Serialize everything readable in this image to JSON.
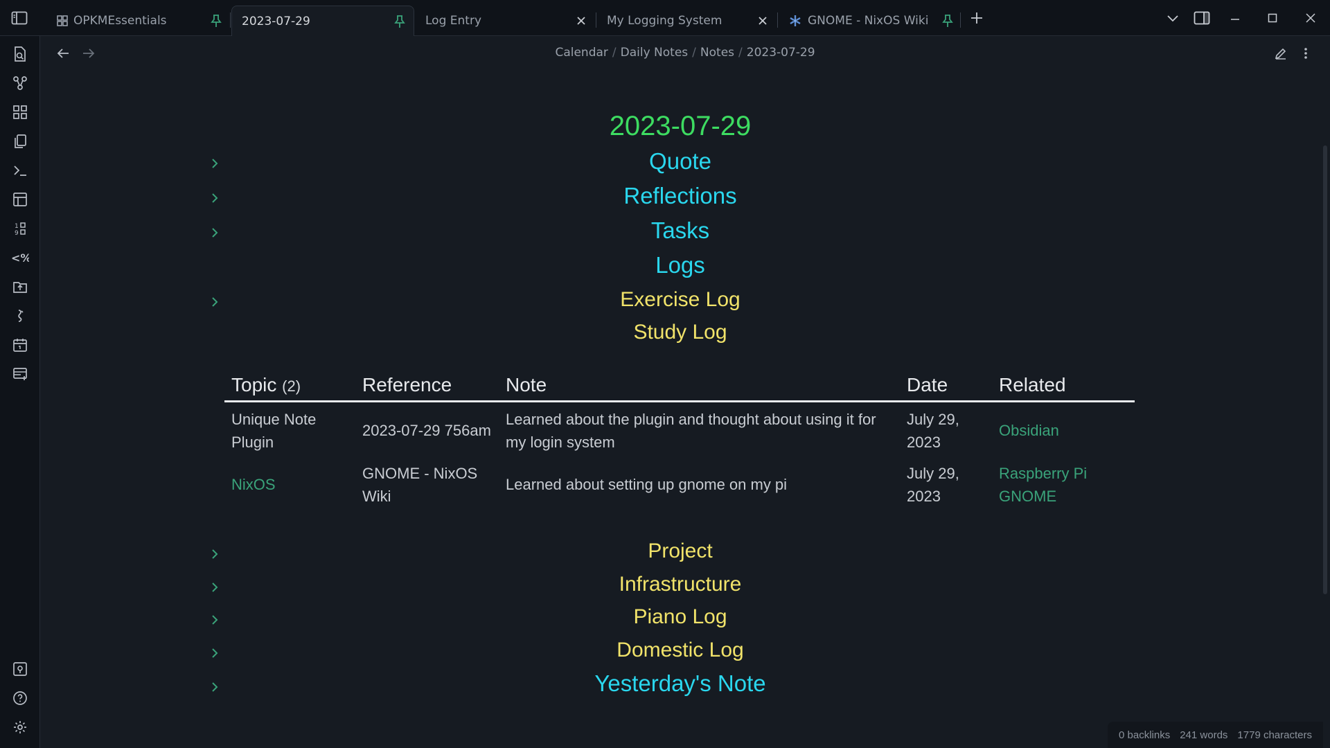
{
  "tabs": [
    {
      "label": "OPKMEssentials",
      "icon": "dashboard-icon",
      "right": "pin-icon",
      "active": false
    },
    {
      "label": "2023-07-29",
      "icon": "",
      "right": "pin-icon",
      "active": true
    },
    {
      "label": "Log Entry",
      "icon": "",
      "right": "close-icon",
      "active": false
    },
    {
      "label": "My Logging System",
      "icon": "",
      "right": "close-icon",
      "active": false
    },
    {
      "label": "GNOME - NixOS Wiki",
      "icon": "nixos-icon",
      "right": "pin-icon",
      "active": false
    }
  ],
  "breadcrumb": [
    "Calendar",
    "Daily Notes",
    "Notes",
    "2023-07-29"
  ],
  "note": {
    "title": "2023-07-29",
    "headings_top": [
      {
        "text": "Quote",
        "color": "cyan",
        "collapsible": true
      },
      {
        "text": "Reflections",
        "color": "cyan",
        "collapsible": true
      },
      {
        "text": "Tasks",
        "color": "cyan",
        "collapsible": true
      },
      {
        "text": "Logs",
        "color": "cyan",
        "collapsible": false
      },
      {
        "text": "Exercise Log",
        "color": "yellow",
        "collapsible": true
      },
      {
        "text": "Study Log",
        "color": "yellow",
        "collapsible": false
      }
    ],
    "table": {
      "headers": {
        "topic": "Topic",
        "topic_count": "(2)",
        "reference": "Reference",
        "note": "Note",
        "date": "Date",
        "related": "Related"
      },
      "rows": [
        {
          "topic": "Unique Note Plugin",
          "topic_link": false,
          "reference": "2023-07-29 756am",
          "note": "Learned about the plugin and thought about using it for my login system",
          "date": "July 29, 2023",
          "related": [
            "Obsidian"
          ]
        },
        {
          "topic": "NixOS",
          "topic_link": true,
          "reference": "GNOME - NixOS Wiki",
          "note": "Learned about setting up gnome on my pi",
          "date": "July 29, 2023",
          "related": [
            "Raspberry Pi",
            "GNOME"
          ]
        }
      ]
    },
    "headings_bottom": [
      {
        "text": "Project",
        "color": "yellow"
      },
      {
        "text": "Infrastructure",
        "color": "yellow"
      },
      {
        "text": "Piano Log",
        "color": "yellow"
      },
      {
        "text": "Domestic Log",
        "color": "yellow"
      },
      {
        "text": "Yesterday's Note",
        "color": "cyan"
      }
    ]
  },
  "status": {
    "backlinks": "0 backlinks",
    "words": "241 words",
    "characters": "1779 characters"
  },
  "colors": {
    "title": "#3ddc61",
    "cyan": "#2ad7ee",
    "yellow": "#f1e36a",
    "link": "#3aa37a",
    "accent": "#3aa37a"
  }
}
